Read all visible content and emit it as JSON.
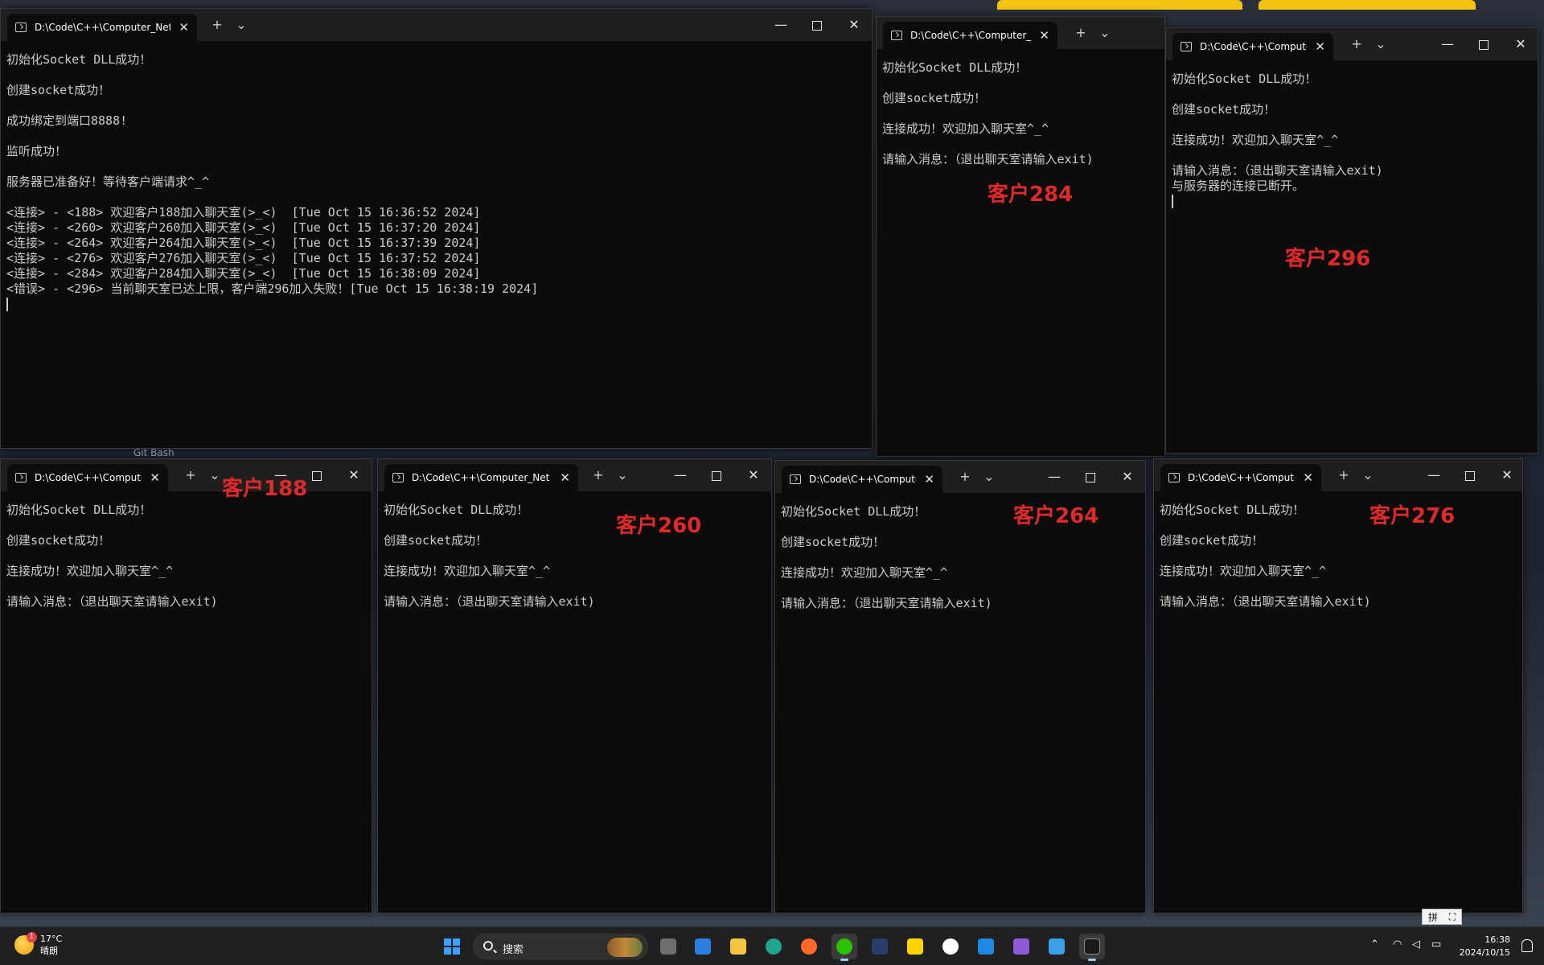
{
  "desktop": {
    "labels": [
      "Git Bash"
    ]
  },
  "server": {
    "tab_title": "D:\\Code\\C++\\Computer_Netw",
    "lines": [
      "初始化Socket DLL成功！",
      "",
      "创建socket成功！",
      "",
      "成功绑定到端口8888!",
      "",
      "监听成功！",
      "",
      "服务器已准备好！等待客户端请求^_^",
      "",
      "<连接> - <188> 欢迎客户188加入聊天室(>_<)  [Tue Oct 15 16:36:52 2024]",
      "<连接> - <260> 欢迎客户260加入聊天室(>_<)  [Tue Oct 15 16:37:20 2024]",
      "<连接> - <264> 欢迎客户264加入聊天室(>_<)  [Tue Oct 15 16:37:39 2024]",
      "<连接> - <276> 欢迎客户276加入聊天室(>_<)  [Tue Oct 15 16:37:52 2024]",
      "<连接> - <284> 欢迎客户284加入聊天室(>_<)  [Tue Oct 15 16:38:09 2024]",
      "<错误> - <296> 当前聊天室已达上限，客户端296加入失败！[Tue Oct 15 16:38:19 2024]"
    ]
  },
  "clients": {
    "c284": {
      "tab_title": "D:\\Code\\C++\\Computer_N",
      "label": "客户284",
      "lines": [
        "初始化Socket DLL成功！",
        "",
        "创建socket成功！",
        "",
        "连接成功！欢迎加入聊天室^_^",
        "",
        "请输入消息：（退出聊天室请输入exit)"
      ]
    },
    "c296": {
      "tab_title": "D:\\Code\\C++\\Compute",
      "label": "客户296",
      "lines": [
        "初始化Socket DLL成功！",
        "",
        "创建socket成功！",
        "",
        "连接成功！欢迎加入聊天室^_^",
        "",
        "请输入消息：（退出聊天室请输入exit)",
        "与服务器的连接已断开。"
      ]
    },
    "c188": {
      "tab_title": "D:\\Code\\C++\\Compute",
      "label": "客户188",
      "lines": [
        "初始化Socket DLL成功！",
        "",
        "创建socket成功！",
        "",
        "连接成功！欢迎加入聊天室^_^",
        "",
        "请输入消息：（退出聊天室请输入exit)"
      ]
    },
    "c260": {
      "tab_title": "D:\\Code\\C++\\Computer_Net",
      "label": "客户260",
      "lines": [
        "初始化Socket DLL成功！",
        "",
        "创建socket成功！",
        "",
        "连接成功！欢迎加入聊天室^_^",
        "",
        "请输入消息：（退出聊天室请输入exit)"
      ]
    },
    "c264": {
      "tab_title": "D:\\Code\\C++\\Compute",
      "label": "客户264",
      "lines": [
        "初始化Socket DLL成功！",
        "",
        "创建socket成功！",
        "",
        "连接成功！欢迎加入聊天室^_^",
        "",
        "请输入消息：（退出聊天室请输入exit)"
      ]
    },
    "c276": {
      "tab_title": "D:\\Code\\C++\\Compute",
      "label": "客户276",
      "lines": [
        "初始化Socket DLL成功！",
        "",
        "创建socket成功！",
        "",
        "连接成功！欢迎加入聊天室^_^",
        "",
        "请输入消息：（退出聊天室请输入exit)"
      ]
    }
  },
  "taskbar": {
    "weather_temp": "17°C",
    "weather_desc": "晴朗",
    "weather_badge": "1",
    "search_placeholder": "搜索",
    "time": "16:38",
    "date": "2024/10/15",
    "ime_label": "拼"
  },
  "icons": {
    "plus": "+",
    "chevron": "⌄",
    "close": "✕",
    "minimize": "—"
  },
  "colors": {
    "label_red": "#e02a2a",
    "console_bg": "#0c0c0c",
    "console_fg": "#cccccc"
  }
}
